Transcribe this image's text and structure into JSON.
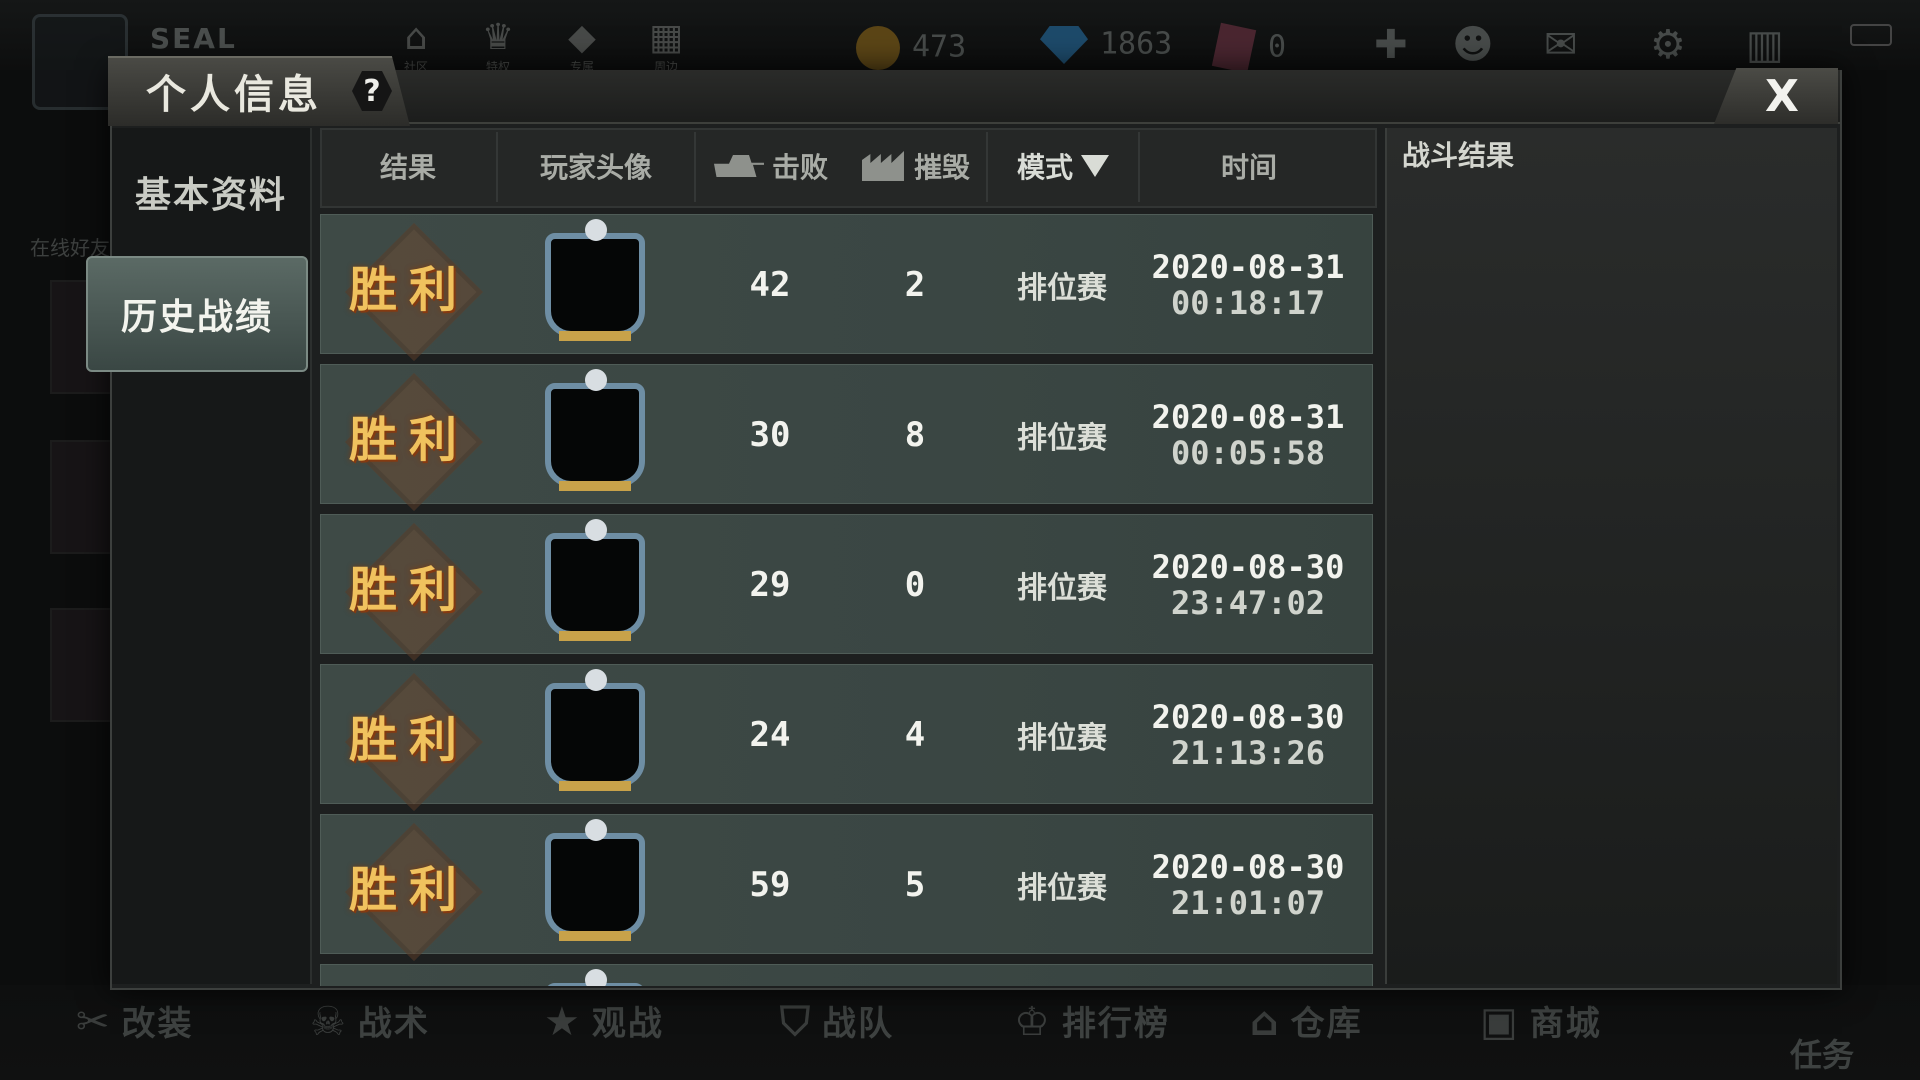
{
  "background": {
    "player_name": "SEAL",
    "top_nav": [
      {
        "icon": "home-icon",
        "label": "社区"
      },
      {
        "icon": "crown-icon",
        "label": "特权"
      },
      {
        "icon": "cube-icon",
        "label": "专属"
      },
      {
        "icon": "grid-icon",
        "label": "周边"
      }
    ],
    "resources": {
      "gold": "473",
      "gems": "1863",
      "cards": "0"
    },
    "left_labels": [
      "在线好友"
    ],
    "bottom_nav": [
      {
        "icon": "wrench-icon",
        "label": "改装"
      },
      {
        "icon": "skull-icon",
        "label": "战术"
      },
      {
        "icon": "star-icon",
        "label": "观战"
      },
      {
        "icon": "shield-icon",
        "label": "战队"
      },
      {
        "icon": "trophy-icon",
        "label": "排行榜"
      },
      {
        "icon": "warehouse-icon",
        "label": "仓库"
      },
      {
        "icon": "shop-icon",
        "label": "商城"
      }
    ],
    "task_label": "任务"
  },
  "modal": {
    "title": "个人信息",
    "help_label": "?",
    "close_label": "X",
    "side_menu": [
      {
        "label": "基本资料",
        "active": false
      },
      {
        "label": "历史战绩",
        "active": true
      }
    ],
    "table": {
      "headers": {
        "result": "结果",
        "avatar": "玩家头像",
        "kills": "击败",
        "destroy": "摧毁",
        "mode": "模式",
        "time": "时间"
      },
      "rows": [
        {
          "result": "胜利",
          "kills": "42",
          "destroy": "2",
          "mode": "排位赛",
          "date": "2020-08-31",
          "time": "00:18:17"
        },
        {
          "result": "胜利",
          "kills": "30",
          "destroy": "8",
          "mode": "排位赛",
          "date": "2020-08-31",
          "time": "00:05:58"
        },
        {
          "result": "胜利",
          "kills": "29",
          "destroy": "0",
          "mode": "排位赛",
          "date": "2020-08-30",
          "time": "23:47:02"
        },
        {
          "result": "胜利",
          "kills": "24",
          "destroy": "4",
          "mode": "排位赛",
          "date": "2020-08-30",
          "time": "21:13:26"
        },
        {
          "result": "胜利",
          "kills": "59",
          "destroy": "5",
          "mode": "排位赛",
          "date": "2020-08-30",
          "time": "21:01:07"
        }
      ]
    },
    "right_panel": {
      "title": "战斗结果"
    }
  },
  "colors": {
    "victory_text": "#f0c25e",
    "row_bg": "#3e4a46",
    "accent_frame": "#6e8ea4"
  }
}
